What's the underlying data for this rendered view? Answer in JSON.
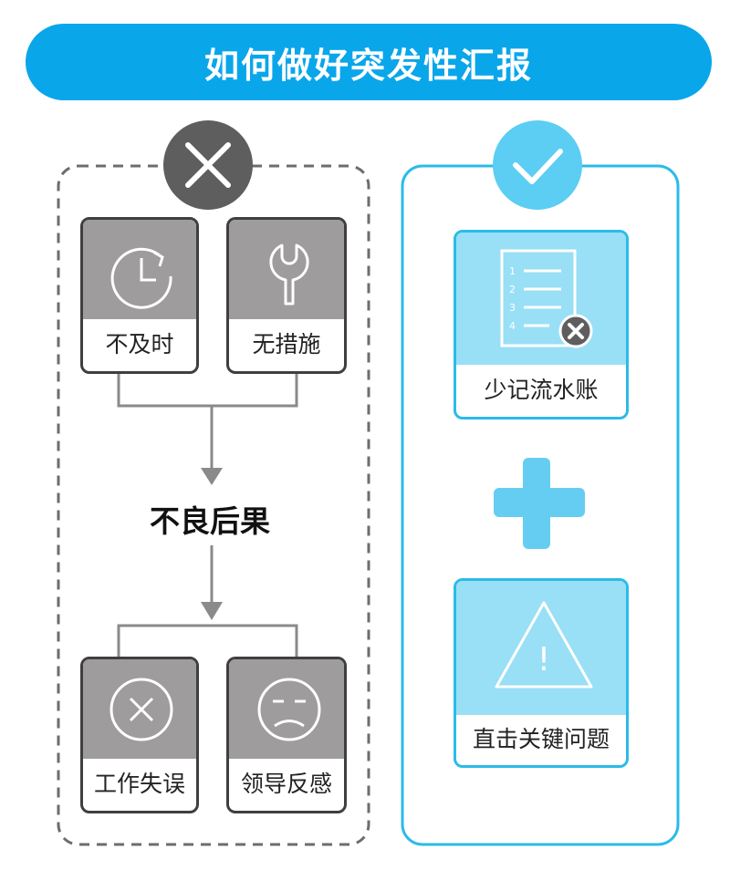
{
  "title": "如何做好突发性汇报",
  "wrong_panel": {
    "icon": "x-mark-icon",
    "causes": [
      {
        "label": "不及时",
        "icon": "clock-icon"
      },
      {
        "label": "无措施",
        "icon": "wrench-icon"
      }
    ],
    "result_label": "不良后果",
    "effects": [
      {
        "label": "工作失误",
        "icon": "circle-x-icon"
      },
      {
        "label": "领导反感",
        "icon": "frown-face-icon"
      }
    ]
  },
  "right_panel": {
    "icon": "checkmark-icon",
    "items": [
      {
        "label": "少记流水账",
        "icon": "list-document-icon",
        "list_numbers": [
          "1",
          "2",
          "3",
          "4"
        ]
      },
      {
        "label": "直击关键问题",
        "icon": "warning-triangle-icon",
        "symbol": "!"
      }
    ],
    "plus_icon": "plus-icon"
  },
  "colors": {
    "banner": "#0aa6ea",
    "gray_header": "#9e9c9c",
    "gray_dark": "#3f3f3f",
    "blue_border": "#2bbbe9",
    "blue_light": "#99dff6",
    "plus": "#66cdf2"
  }
}
